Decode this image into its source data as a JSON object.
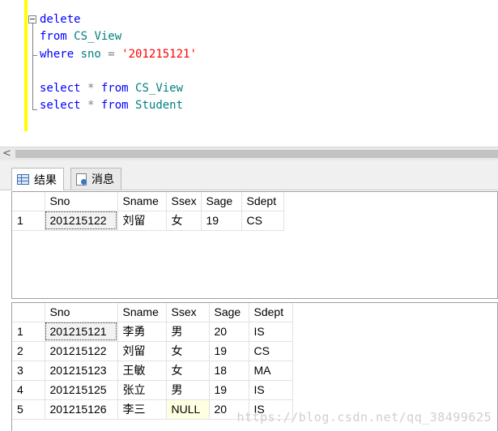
{
  "editor": {
    "lines": [
      [
        {
          "t": "delete",
          "c": "kw"
        }
      ],
      [
        {
          "t": "from ",
          "c": "kw"
        },
        {
          "t": "CS_View",
          "c": "obj"
        }
      ],
      [
        {
          "t": "where ",
          "c": "kw"
        },
        {
          "t": "sno",
          "c": "id"
        },
        {
          "t": " = ",
          "c": "op"
        },
        {
          "t": "'201215121'",
          "c": "str"
        }
      ],
      [],
      [
        {
          "t": "select ",
          "c": "kw"
        },
        {
          "t": "*",
          "c": "op"
        },
        {
          "t": " from ",
          "c": "kw"
        },
        {
          "t": "CS_View",
          "c": "obj"
        }
      ],
      [
        {
          "t": "select ",
          "c": "kw"
        },
        {
          "t": "*",
          "c": "op"
        },
        {
          "t": " from ",
          "c": "kw"
        },
        {
          "t": "Student",
          "c": "obj"
        }
      ]
    ]
  },
  "scrollbar": {
    "left_arrow": "<"
  },
  "tabs": {
    "results": {
      "icon": "grid-icon",
      "label": "结果"
    },
    "messages": {
      "icon": "message-icon",
      "label": "消息"
    }
  },
  "results": [
    {
      "columns": [
        "Sno",
        "Sname",
        "Ssex",
        "Sage",
        "Sdept"
      ],
      "rows": [
        [
          "1",
          "201215122",
          "刘留",
          "女",
          "19",
          "CS"
        ]
      ]
    },
    {
      "columns": [
        "Sno",
        "Sname",
        "Ssex",
        "Sage",
        "Sdept"
      ],
      "rows": [
        [
          "1",
          "201215121",
          "李勇",
          "男",
          "20",
          "IS"
        ],
        [
          "2",
          "201215122",
          "刘留",
          "女",
          "19",
          "CS"
        ],
        [
          "3",
          "201215123",
          "王敏",
          "女",
          "18",
          "MA"
        ],
        [
          "4",
          "201215125",
          "张立",
          "男",
          "19",
          "IS"
        ],
        [
          "5",
          "201215126",
          "李三",
          "NULL",
          "20",
          "IS"
        ]
      ]
    }
  ],
  "watermark": "https://blog.csdn.net/qq_38499625",
  "colors": {
    "keyword": "#0000ff",
    "object": "#008080",
    "string": "#ff0000",
    "operator": "#808080",
    "change_bar": "#ffff00",
    "null_cell": "#ffffe1"
  }
}
